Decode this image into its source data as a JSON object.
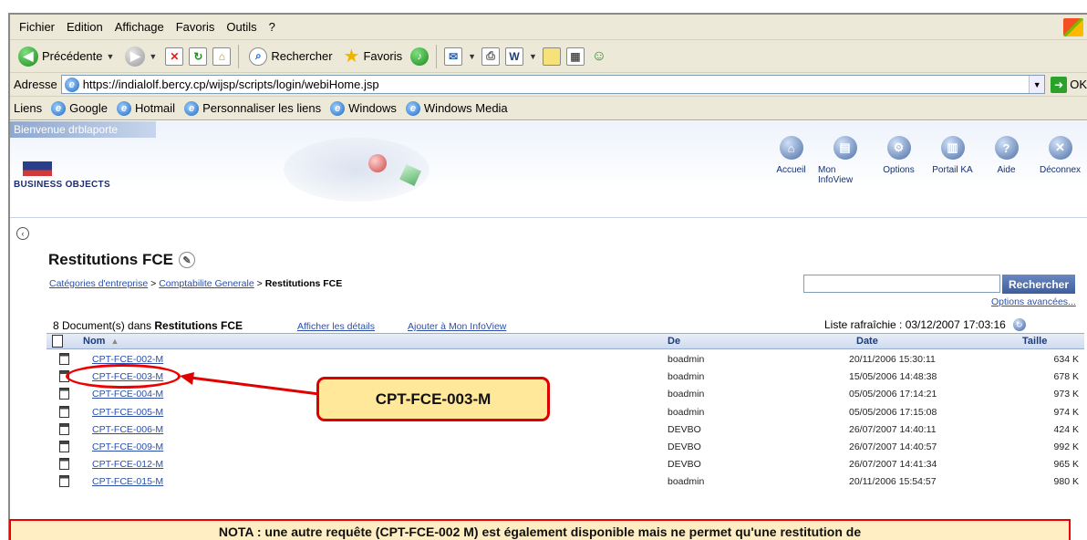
{
  "menu": [
    "Fichier",
    "Edition",
    "Affichage",
    "Favoris",
    "Outils",
    "?"
  ],
  "toolbar": {
    "back_label": "Précédente",
    "search_label": "Rechercher",
    "favorites_label": "Favoris"
  },
  "address": {
    "label": "Adresse",
    "url": "https://indialolf.bercy.cp/wijsp/scripts/login/webiHome.jsp",
    "go_label": "OK"
  },
  "links": {
    "label": "Liens",
    "items": [
      "Google",
      "Hotmail",
      "Personnaliser les liens",
      "Windows",
      "Windows Media"
    ]
  },
  "bo": {
    "welcome": "Bienvenue drblaporte",
    "logo_text": "BUSINESS OBJECTS",
    "nav": [
      {
        "label": "Accueil",
        "icon": "home-icon"
      },
      {
        "label": "Mon InfoView",
        "icon": "infoview-icon"
      },
      {
        "label": "Options",
        "icon": "options-icon"
      },
      {
        "label": "Portail KA",
        "icon": "portal-icon"
      },
      {
        "label": "Aide",
        "icon": "help-icon"
      },
      {
        "label": "Déconnex",
        "icon": "logout-icon"
      }
    ]
  },
  "page": {
    "title": "Restitutions FCE",
    "breadcrumb": [
      "Catégories d'entreprise",
      "Comptabilite Generale",
      "Restitutions FCE"
    ],
    "search_button": "Rechercher",
    "advanced_options": "Options avancées...",
    "doc_count_prefix": "8 Document(s) dans",
    "doc_count_folder": "Restitutions FCE",
    "show_details": "Afficher les détails",
    "add_to_infoview": "Ajouter à Mon InfoView",
    "refreshed": "Liste rafraîchie : 03/12/2007 17:03:16"
  },
  "table": {
    "headers": {
      "name": "Nom",
      "from": "De",
      "date": "Date",
      "size": "Taille"
    },
    "rows": [
      {
        "name": "CPT-FCE-002-M",
        "from": "boadmin",
        "date": "20/11/2006 15:30:11",
        "size": "634 K"
      },
      {
        "name": "CPT-FCE-003-M",
        "from": "boadmin",
        "date": "15/05/2006 14:48:38",
        "size": "678 K"
      },
      {
        "name": "CPT-FCE-004-M",
        "from": "boadmin",
        "date": "05/05/2006 17:14:21",
        "size": "973 K"
      },
      {
        "name": "CPT-FCE-005-M",
        "from": "boadmin",
        "date": "05/05/2006 17:15:08",
        "size": "974 K"
      },
      {
        "name": "CPT-FCE-006-M",
        "from": "DEVBO",
        "date": "26/07/2007 14:40:11",
        "size": "424 K"
      },
      {
        "name": "CPT-FCE-009-M",
        "from": "DEVBO",
        "date": "26/07/2007 14:40:57",
        "size": "992 K"
      },
      {
        "name": "CPT-FCE-012-M",
        "from": "DEVBO",
        "date": "26/07/2007 14:41:34",
        "size": "965 K"
      },
      {
        "name": "CPT-FCE-015-M",
        "from": "boadmin",
        "date": "20/11/2006 15:54:57",
        "size": "980 K"
      }
    ]
  },
  "annotation": {
    "callout": "CPT-FCE-003-M",
    "nota": "NOTA : une autre requête (CPT-FCE-002 M) est également disponible mais ne permet qu'une restitution de",
    "color": "#e00000"
  }
}
